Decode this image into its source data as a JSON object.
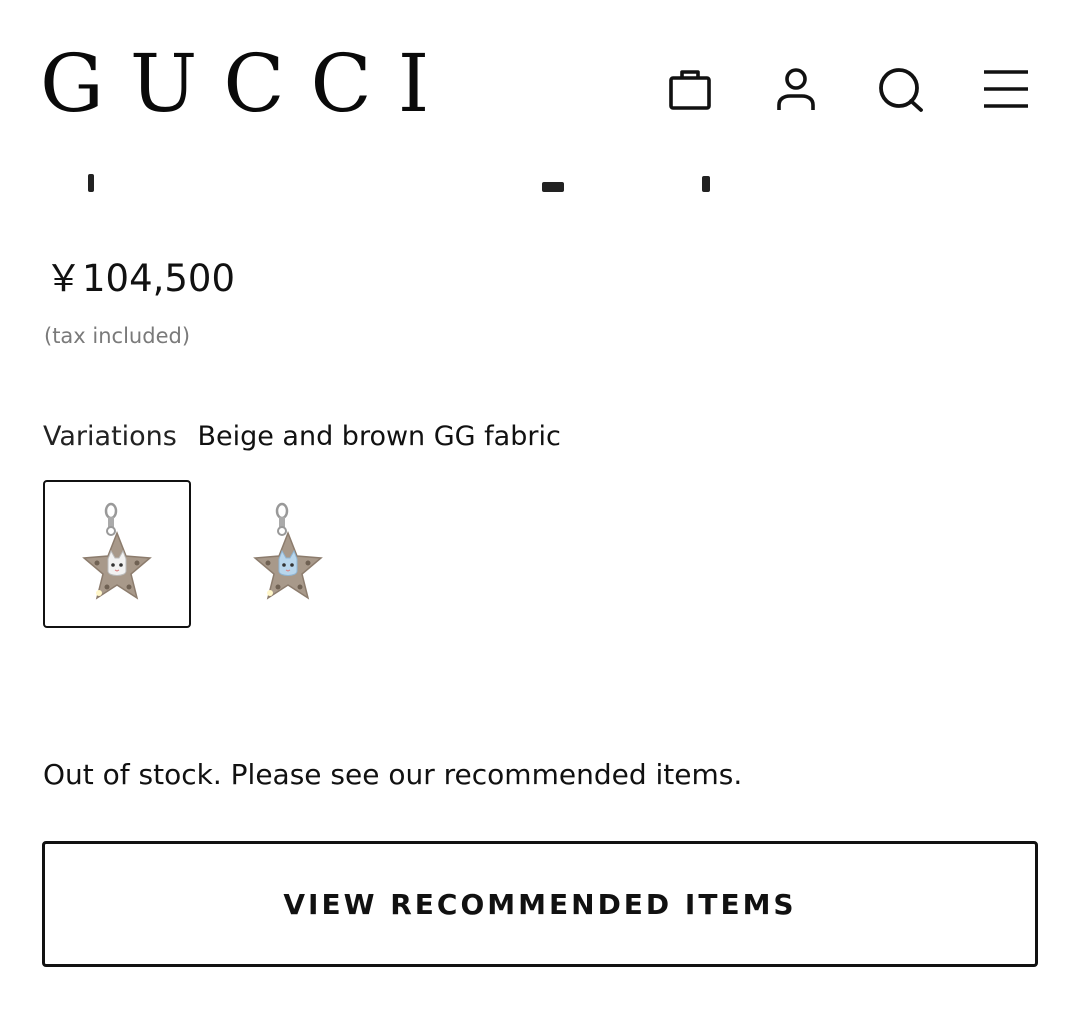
{
  "header": {
    "logo_text": "GUCCI",
    "icons": [
      "shopping-bag-icon",
      "account-icon",
      "search-icon",
      "menu-icon"
    ]
  },
  "product": {
    "price": "￥104,500",
    "tax_note": "(tax included)",
    "variations_label": "Variations",
    "variations_value": "Beige and brown GG fabric",
    "variants": [
      {
        "selected": true,
        "icon": "star-keychain-white-cat"
      },
      {
        "selected": false,
        "icon": "star-keychain-blue-cat"
      }
    ],
    "stock_message": "Out of stock. Please see our recommended items.",
    "cta_label": "VIEW RECOMMENDED ITEMS"
  },
  "colors": {
    "text": "#111111",
    "muted": "#7a7a7a",
    "fabric": "#a8998a",
    "fabric_dark": "#8c7c6d"
  }
}
